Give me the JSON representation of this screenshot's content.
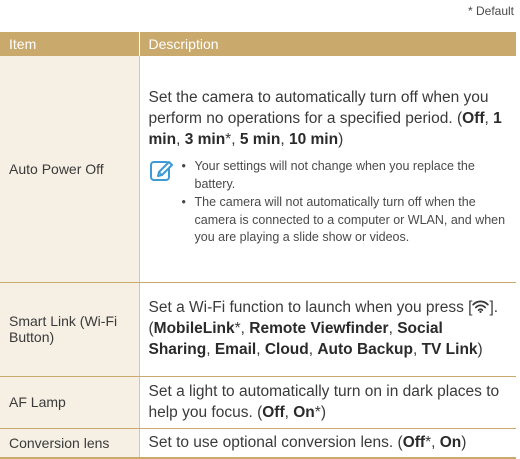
{
  "default_note": "* Default",
  "header": {
    "item": "Item",
    "description": "Description"
  },
  "rows": [
    {
      "item": "Auto Power Off",
      "desc": {
        "line1": "Set the camera to automatically turn off when you perform no operations for a specified period.",
        "options_open": "(",
        "opt_off": "Off",
        "opt_1min": "1 min",
        "opt_3min": "3 min",
        "star": "*",
        "opt_5min": "5 min",
        "opt_10min": "10 min",
        "options_close": ")",
        "sep": ", "
      },
      "notes": [
        "Your settings will not change when you replace the battery.",
        "The camera will not automatically turn off when the camera is connected to a computer or WLAN, and when you are playing a slide show or videos."
      ]
    },
    {
      "item": "Smart Link (Wi-Fi Button)",
      "desc": {
        "text1": "Set a Wi-Fi function to launch when you press [",
        "text2": "]. (",
        "opt_mobilelink": "MobileLink",
        "star": "*",
        "opt_remote": "Remote Viewfinder",
        "opt_social": "Social Sharing",
        "opt_email": "Email",
        "opt_cloud": "Cloud",
        "opt_autobackup": "Auto Backup",
        "opt_tvlink": "TV Link",
        "close": ")",
        "sep": ", "
      }
    },
    {
      "item": "AF Lamp",
      "desc": {
        "text1": "Set a light to automatically turn on in dark places to help you focus. (",
        "opt_off": "Off",
        "opt_on": "On",
        "star": "*",
        "close": ")",
        "sep": ", "
      }
    },
    {
      "item": "Conversion lens",
      "desc": {
        "text1": "Set to use optional conversion lens. (",
        "opt_off": "Off",
        "star": "*",
        "opt_on": "On",
        "close": ")",
        "sep": ", "
      }
    }
  ],
  "icons": {
    "note": "note-pencil-icon",
    "wifi": "wifi-icon"
  },
  "colors": {
    "header_bg": "#c9a96c",
    "item_bg": "#f5efe4",
    "note_icon": "#3d9ad4"
  }
}
